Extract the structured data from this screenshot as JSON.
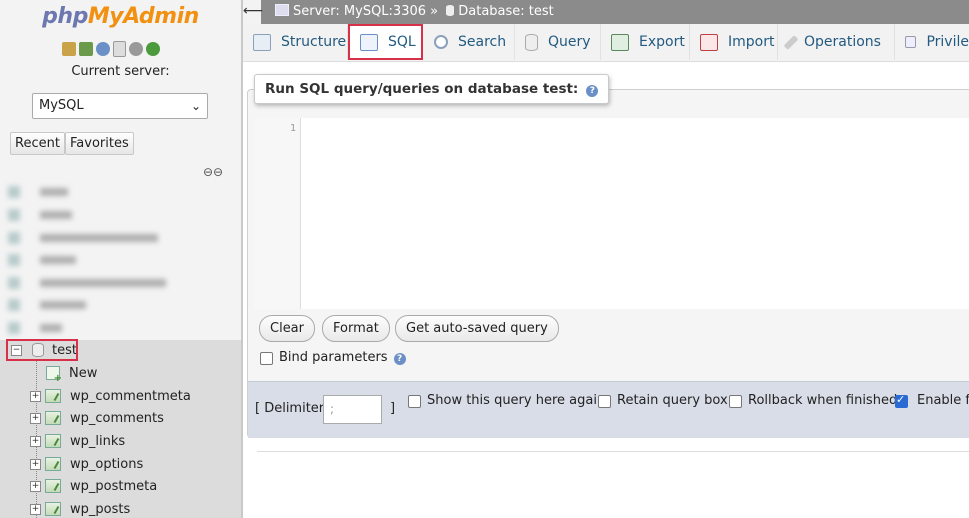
{
  "nav": {
    "logo_php": "php",
    "logo_admin": "MyAdmin",
    "current_server_label": "Current server:",
    "server_select": "MySQL",
    "recent_button": "Recent",
    "favorites_button": "Favorites",
    "tree": {
      "active_db": "test",
      "items": [
        "New",
        "wp_commentmeta",
        "wp_comments",
        "wp_links",
        "wp_options",
        "wp_postmeta",
        "wp_posts"
      ]
    }
  },
  "breadcrumb": {
    "server": "Server: MySQL:3306",
    "separator": "»",
    "database": "Database: test"
  },
  "tabs": [
    "Structure",
    "SQL",
    "Search",
    "Query",
    "Export",
    "Import",
    "Operations",
    "Privile"
  ],
  "sql_panel": {
    "legend": "Run SQL query/queries on database test:",
    "line_number": "1",
    "buttons": [
      "Clear",
      "Format",
      "Get auto-saved query"
    ],
    "bind_parameters": "Bind parameters",
    "delimiter_label_open": "[ Delimiter",
    "delimiter_value": ";",
    "delimiter_label_close": "]",
    "options": [
      {
        "label": "Show this query here again",
        "checked": false
      },
      {
        "label": "Retain query box",
        "checked": false
      },
      {
        "label": "Rollback when finished",
        "checked": false
      },
      {
        "label": "Enable fo",
        "checked": true
      }
    ]
  },
  "colors": {
    "active_tab_border": "#d9304a",
    "tab_text": "#235a81",
    "logo_php": "#6c78af",
    "logo_admin": "#f29111",
    "footer_bar": "#d8dde7"
  }
}
